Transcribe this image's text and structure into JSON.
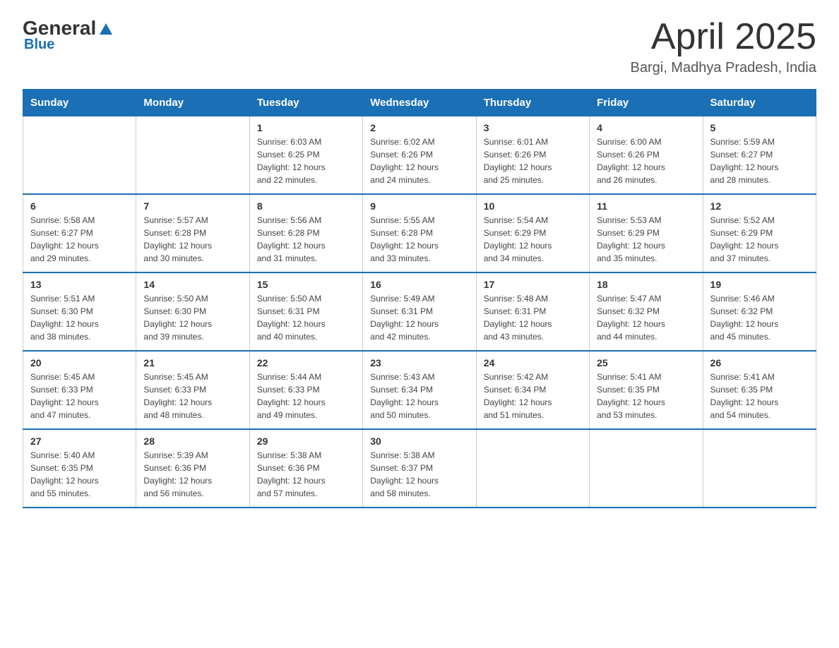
{
  "header": {
    "logo_general": "General",
    "logo_blue": "Blue",
    "cal_title": "April 2025",
    "cal_subtitle": "Bargi, Madhya Pradesh, India"
  },
  "weekdays": [
    "Sunday",
    "Monday",
    "Tuesday",
    "Wednesday",
    "Thursday",
    "Friday",
    "Saturday"
  ],
  "weeks": [
    [
      {
        "day": "",
        "info": ""
      },
      {
        "day": "",
        "info": ""
      },
      {
        "day": "1",
        "info": "Sunrise: 6:03 AM\nSunset: 6:25 PM\nDaylight: 12 hours\nand 22 minutes."
      },
      {
        "day": "2",
        "info": "Sunrise: 6:02 AM\nSunset: 6:26 PM\nDaylight: 12 hours\nand 24 minutes."
      },
      {
        "day": "3",
        "info": "Sunrise: 6:01 AM\nSunset: 6:26 PM\nDaylight: 12 hours\nand 25 minutes."
      },
      {
        "day": "4",
        "info": "Sunrise: 6:00 AM\nSunset: 6:26 PM\nDaylight: 12 hours\nand 26 minutes."
      },
      {
        "day": "5",
        "info": "Sunrise: 5:59 AM\nSunset: 6:27 PM\nDaylight: 12 hours\nand 28 minutes."
      }
    ],
    [
      {
        "day": "6",
        "info": "Sunrise: 5:58 AM\nSunset: 6:27 PM\nDaylight: 12 hours\nand 29 minutes."
      },
      {
        "day": "7",
        "info": "Sunrise: 5:57 AM\nSunset: 6:28 PM\nDaylight: 12 hours\nand 30 minutes."
      },
      {
        "day": "8",
        "info": "Sunrise: 5:56 AM\nSunset: 6:28 PM\nDaylight: 12 hours\nand 31 minutes."
      },
      {
        "day": "9",
        "info": "Sunrise: 5:55 AM\nSunset: 6:28 PM\nDaylight: 12 hours\nand 33 minutes."
      },
      {
        "day": "10",
        "info": "Sunrise: 5:54 AM\nSunset: 6:29 PM\nDaylight: 12 hours\nand 34 minutes."
      },
      {
        "day": "11",
        "info": "Sunrise: 5:53 AM\nSunset: 6:29 PM\nDaylight: 12 hours\nand 35 minutes."
      },
      {
        "day": "12",
        "info": "Sunrise: 5:52 AM\nSunset: 6:29 PM\nDaylight: 12 hours\nand 37 minutes."
      }
    ],
    [
      {
        "day": "13",
        "info": "Sunrise: 5:51 AM\nSunset: 6:30 PM\nDaylight: 12 hours\nand 38 minutes."
      },
      {
        "day": "14",
        "info": "Sunrise: 5:50 AM\nSunset: 6:30 PM\nDaylight: 12 hours\nand 39 minutes."
      },
      {
        "day": "15",
        "info": "Sunrise: 5:50 AM\nSunset: 6:31 PM\nDaylight: 12 hours\nand 40 minutes."
      },
      {
        "day": "16",
        "info": "Sunrise: 5:49 AM\nSunset: 6:31 PM\nDaylight: 12 hours\nand 42 minutes."
      },
      {
        "day": "17",
        "info": "Sunrise: 5:48 AM\nSunset: 6:31 PM\nDaylight: 12 hours\nand 43 minutes."
      },
      {
        "day": "18",
        "info": "Sunrise: 5:47 AM\nSunset: 6:32 PM\nDaylight: 12 hours\nand 44 minutes."
      },
      {
        "day": "19",
        "info": "Sunrise: 5:46 AM\nSunset: 6:32 PM\nDaylight: 12 hours\nand 45 minutes."
      }
    ],
    [
      {
        "day": "20",
        "info": "Sunrise: 5:45 AM\nSunset: 6:33 PM\nDaylight: 12 hours\nand 47 minutes."
      },
      {
        "day": "21",
        "info": "Sunrise: 5:45 AM\nSunset: 6:33 PM\nDaylight: 12 hours\nand 48 minutes."
      },
      {
        "day": "22",
        "info": "Sunrise: 5:44 AM\nSunset: 6:33 PM\nDaylight: 12 hours\nand 49 minutes."
      },
      {
        "day": "23",
        "info": "Sunrise: 5:43 AM\nSunset: 6:34 PM\nDaylight: 12 hours\nand 50 minutes."
      },
      {
        "day": "24",
        "info": "Sunrise: 5:42 AM\nSunset: 6:34 PM\nDaylight: 12 hours\nand 51 minutes."
      },
      {
        "day": "25",
        "info": "Sunrise: 5:41 AM\nSunset: 6:35 PM\nDaylight: 12 hours\nand 53 minutes."
      },
      {
        "day": "26",
        "info": "Sunrise: 5:41 AM\nSunset: 6:35 PM\nDaylight: 12 hours\nand 54 minutes."
      }
    ],
    [
      {
        "day": "27",
        "info": "Sunrise: 5:40 AM\nSunset: 6:35 PM\nDaylight: 12 hours\nand 55 minutes."
      },
      {
        "day": "28",
        "info": "Sunrise: 5:39 AM\nSunset: 6:36 PM\nDaylight: 12 hours\nand 56 minutes."
      },
      {
        "day": "29",
        "info": "Sunrise: 5:38 AM\nSunset: 6:36 PM\nDaylight: 12 hours\nand 57 minutes."
      },
      {
        "day": "30",
        "info": "Sunrise: 5:38 AM\nSunset: 6:37 PM\nDaylight: 12 hours\nand 58 minutes."
      },
      {
        "day": "",
        "info": ""
      },
      {
        "day": "",
        "info": ""
      },
      {
        "day": "",
        "info": ""
      }
    ]
  ]
}
